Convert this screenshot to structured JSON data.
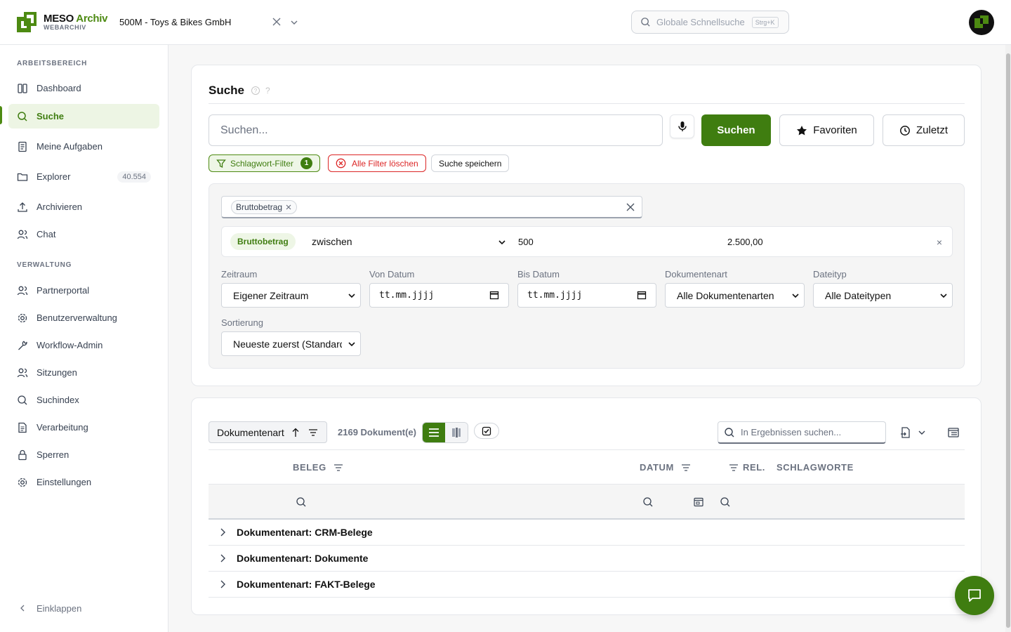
{
  "brand": {
    "name_part1": "MESO ",
    "name_part2": "Archiv",
    "subtitle": "WEBARCHIV",
    "accent_color": "#4d8a12"
  },
  "header": {
    "tenant": "500M - Toys & Bikes GmbH",
    "global_search_placeholder": "Globale Schnellsuche",
    "global_search_shortcut": "Strg+K"
  },
  "sidebar": {
    "section_work": "ARBEITSBEREICH",
    "section_admin": "VERWALTUNG",
    "items": [
      {
        "label": "Dashboard",
        "icon": "dashboard-icon"
      },
      {
        "label": "Suche",
        "icon": "search-icon",
        "active": true
      },
      {
        "label": "Meine Aufgaben",
        "icon": "tasks-icon"
      },
      {
        "label": "Explorer",
        "icon": "folder-icon",
        "badge": "40.554"
      },
      {
        "label": "Archivieren",
        "icon": "upload-icon"
      },
      {
        "label": "Chat",
        "icon": "users-icon"
      }
    ],
    "admin_items": [
      {
        "label": "Partnerportal",
        "icon": "users-icon"
      },
      {
        "label": "Benutzerverwaltung",
        "icon": "gear-icon"
      },
      {
        "label": "Workflow-Admin",
        "icon": "wrench-icon"
      },
      {
        "label": "Sitzungen",
        "icon": "users-icon"
      },
      {
        "label": "Suchindex",
        "icon": "search-icon"
      },
      {
        "label": "Verarbeitung",
        "icon": "document-icon"
      },
      {
        "label": "Sperren",
        "icon": "lock-icon"
      },
      {
        "label": "Einstellungen",
        "icon": "gear-icon"
      }
    ],
    "collapse_label": "Einklappen"
  },
  "search": {
    "title": "Suche",
    "help_q": "?",
    "input_placeholder": "Suchen...",
    "search_button": "Suchen",
    "favorites_button": "Favoriten",
    "recent_button": "Zuletzt",
    "chip_filter": "Schlagwort-Filter",
    "chip_filter_count": "1",
    "chip_clear": "Alle Filter löschen",
    "chip_save": "Suche speichern",
    "tag": "Bruttobetrag",
    "condition": {
      "field": "Bruttobetrag",
      "operator": "zwischen",
      "value_from": "500",
      "value_to": "2.500,00",
      "remove": "×"
    },
    "fields": {
      "zeitraum_label": "Zeitraum",
      "zeitraum_value": "Eigener Zeitraum",
      "von_label": "Von Datum",
      "von_value": "tt.mm.jjjj",
      "bis_label": "Bis Datum",
      "bis_value": "tt.mm.jjjj",
      "doktyp_label": "Dokumentenart",
      "doktyp_value": "Alle Dokumentenarten",
      "dateityp_label": "Dateityp",
      "dateityp_value": "Alle Dateitypen",
      "sort_label": "Sortierung",
      "sort_value": "Neueste zuerst (Standard)"
    }
  },
  "results": {
    "group_by": "Dokumentenart",
    "count": "2169 Dokument(e)",
    "search_placeholder": "In Ergebnissen suchen...",
    "columns": [
      "BELEG",
      "DATUM",
      "REL.",
      "SCHLAGWORTE"
    ],
    "groups": [
      "Dokumentenart: CRM-Belege",
      "Dokumentenart: Dokumente",
      "Dokumentenart: FAKT-Belege"
    ]
  }
}
